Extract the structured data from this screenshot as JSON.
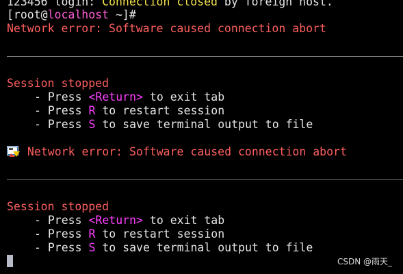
{
  "lines": {
    "l1_prefix": "123456 login: ",
    "l1_highlight": "Connection closed",
    "l1_suffix": " by foreign host.",
    "prompt_open": "[root@",
    "prompt_host": "localhost",
    "prompt_close": " ~]#",
    "network_error": "Network error: Software caused connection abort"
  },
  "sessions": [
    {
      "stopped": "Session stopped",
      "bullet": "- Press ",
      "return_key": "<Return>",
      "return_text": " to exit tab",
      "r_key": "R",
      "r_text": " to restart session",
      "s_key": "S",
      "s_text": " to save terminal output to file"
    },
    {
      "network_error": "Network error: Software caused connection abort",
      "stopped": "Session stopped",
      "bullet": "- Press ",
      "return_key": "<Return>",
      "return_text": " to exit tab",
      "r_key": "R",
      "r_text": " to restart session",
      "s_key": "S",
      "s_text": " to save terminal output to file"
    }
  ],
  "icons": {
    "warning": "warning-icon"
  },
  "colors": {
    "background": "#000000",
    "error": "#ff5f5f",
    "highlight": "#f2e14c",
    "key": "#ff40ff",
    "text": "#e6e6e6"
  },
  "watermark": "CSDN @雨天_"
}
